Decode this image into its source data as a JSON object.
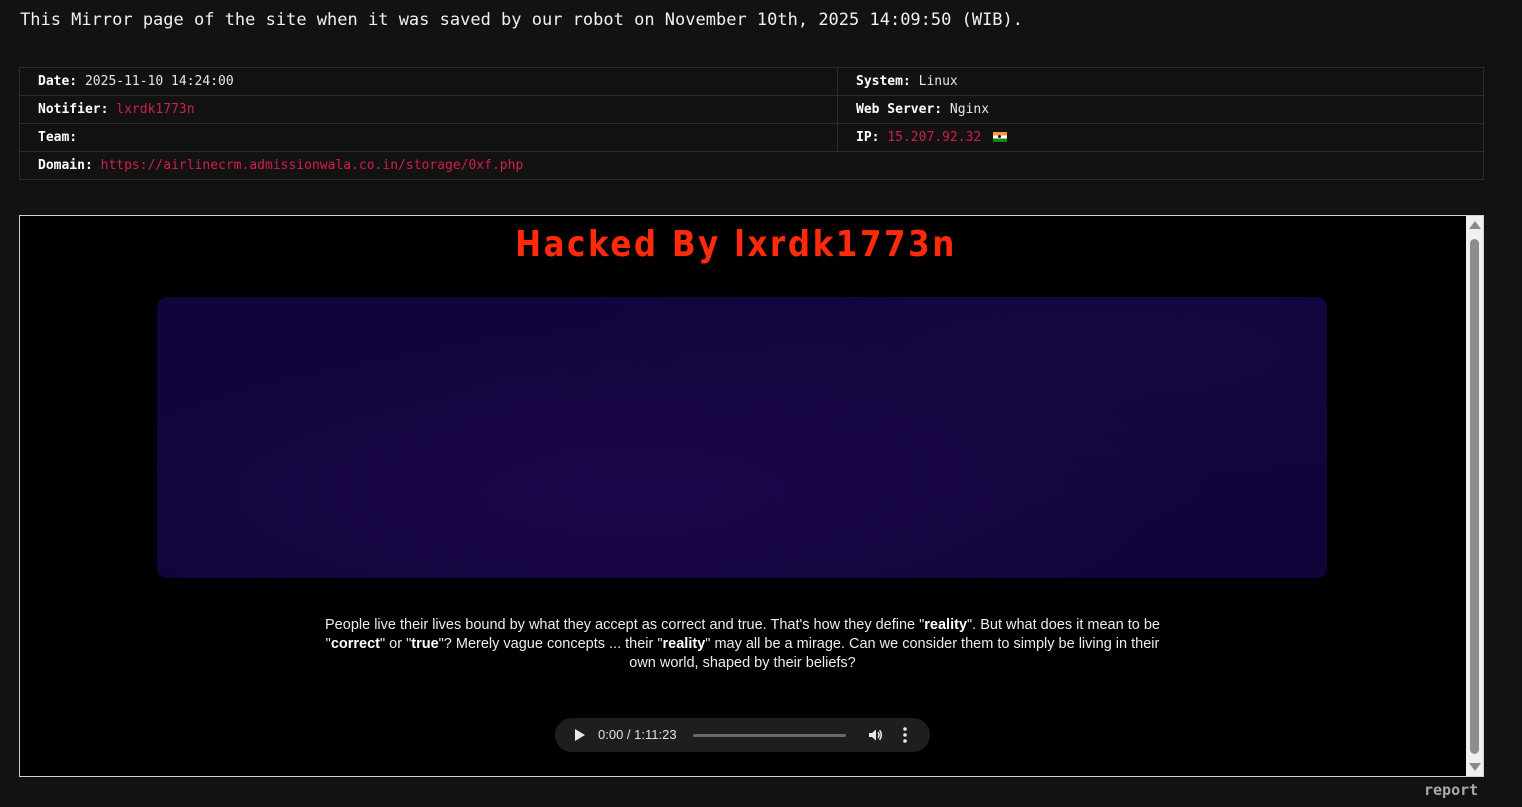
{
  "header": {
    "mirror_notice": "This Mirror page of the site when it was saved by our robot on November 10th, 2025 14:09:50 (WIB)."
  },
  "info": {
    "date_label": "Date:",
    "date_value": "2025-11-10 14:24:00",
    "system_label": "System:",
    "system_value": "Linux",
    "notifier_label": "Notifier:",
    "notifier_value": "lxrdk1773n",
    "webserver_label": "Web Server:",
    "webserver_value": "Nginx",
    "team_label": "Team:",
    "team_value": "",
    "ip_label": "IP:",
    "ip_value": "15.207.92.32",
    "ip_flag_icon": "india-flag-icon",
    "domain_label": "Domain:",
    "domain_value": "https://airlinecrm.admissionwala.co.in/storage/0xf.php"
  },
  "mirror": {
    "title": "Hacked By lxrdk1773n",
    "quote_parts": [
      "People live their lives bound by what they accept as correct and true. That's how they define \"",
      "reality",
      "\". But what does it mean to be \"",
      "correct",
      "\" or \"",
      "true",
      "\"? Merely vague concepts ... their \"",
      "reality",
      "\" may all be a mirage. Can we consider them to simply be living in their own world, shaped by their beliefs?"
    ],
    "audio": {
      "time": "0:00 / 1:11:23",
      "progress": 0
    }
  },
  "footer": {
    "report_label": "report"
  },
  "colors": {
    "background": "#121212",
    "accent_red": "#d21f4a",
    "title_red": "#ff2a0a",
    "panel_purple": "#10043a"
  }
}
